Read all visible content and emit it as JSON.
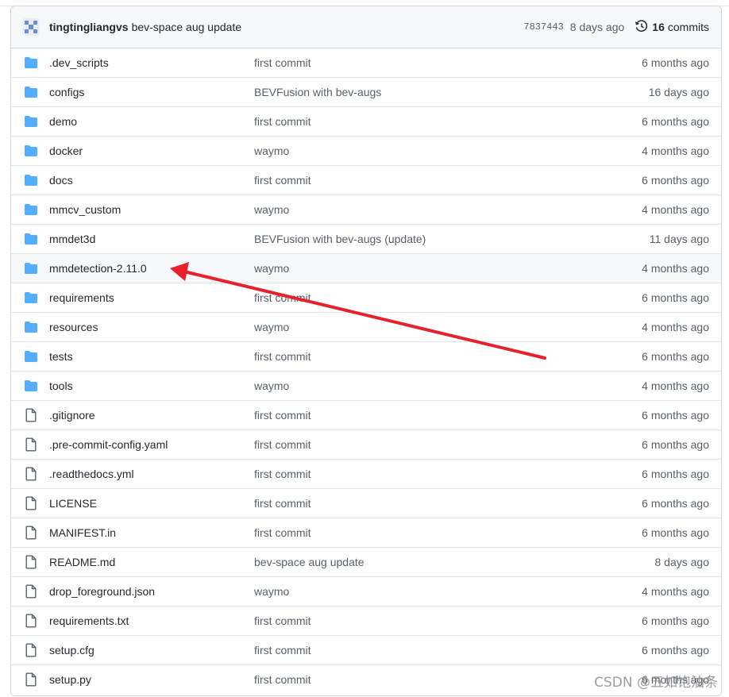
{
  "commit": {
    "author": "tingtingliangvs",
    "message": "bev-space aug update",
    "sha": "7837443",
    "date": "8 days ago",
    "commit_count": "16",
    "commits_label": "commits"
  },
  "files": [
    {
      "name": ".dev_scripts",
      "type": "folder",
      "message": "first commit",
      "age": "6 months ago"
    },
    {
      "name": "configs",
      "type": "folder",
      "message": "BEVFusion with bev-augs",
      "age": "16 days ago"
    },
    {
      "name": "demo",
      "type": "folder",
      "message": "first commit",
      "age": "6 months ago"
    },
    {
      "name": "docker",
      "type": "folder",
      "message": "waymo",
      "age": "4 months ago"
    },
    {
      "name": "docs",
      "type": "folder",
      "message": "first commit",
      "age": "6 months ago"
    },
    {
      "name": "mmcv_custom",
      "type": "folder",
      "message": "waymo",
      "age": "4 months ago"
    },
    {
      "name": "mmdet3d",
      "type": "folder",
      "message": "BEVFusion with bev-augs (update)",
      "age": "11 days ago"
    },
    {
      "name": "mmdetection-2.11.0",
      "type": "folder",
      "message": "waymo",
      "age": "4 months ago"
    },
    {
      "name": "requirements",
      "type": "folder",
      "message": "first commit",
      "age": "6 months ago"
    },
    {
      "name": "resources",
      "type": "folder",
      "message": "waymo",
      "age": "4 months ago"
    },
    {
      "name": "tests",
      "type": "folder",
      "message": "first commit",
      "age": "6 months ago"
    },
    {
      "name": "tools",
      "type": "folder",
      "message": "waymo",
      "age": "4 months ago"
    },
    {
      "name": ".gitignore",
      "type": "file",
      "message": "first commit",
      "age": "6 months ago"
    },
    {
      "name": ".pre-commit-config.yaml",
      "type": "file",
      "message": "first commit",
      "age": "6 months ago"
    },
    {
      "name": ".readthedocs.yml",
      "type": "file",
      "message": "first commit",
      "age": "6 months ago"
    },
    {
      "name": "LICENSE",
      "type": "file",
      "message": "first commit",
      "age": "6 months ago"
    },
    {
      "name": "MANIFEST.in",
      "type": "file",
      "message": "first commit",
      "age": "6 months ago"
    },
    {
      "name": "README.md",
      "type": "file",
      "message": "bev-space aug update",
      "age": "8 days ago"
    },
    {
      "name": "drop_foreground.json",
      "type": "file",
      "message": "waymo",
      "age": "4 months ago"
    },
    {
      "name": "requirements.txt",
      "type": "file",
      "message": "first commit",
      "age": "6 months ago"
    },
    {
      "name": "setup.cfg",
      "type": "file",
      "message": "first commit",
      "age": "6 months ago"
    },
    {
      "name": "setup.py",
      "type": "file",
      "message": "first commit",
      "age": "6 months ago"
    }
  ],
  "watermark": "CSDN @五如饱油条",
  "colors": {
    "folder": "#54aeff",
    "arrow": "#e8202a",
    "file_icon": "#57606a"
  }
}
